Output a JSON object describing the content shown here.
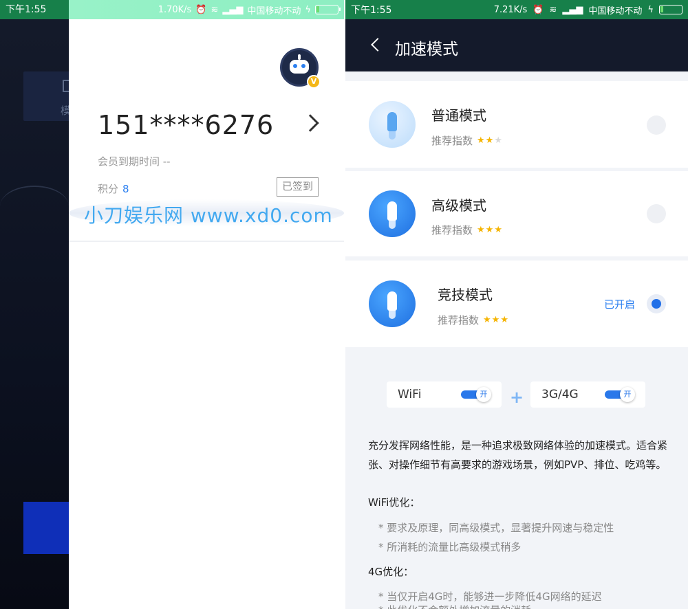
{
  "left": {
    "bg_status_time": "下午1:55",
    "bg_card_text": "模",
    "status": {
      "speed": "1.70K/s",
      "carrier": "中国移动不动"
    },
    "avatar_badge": "V",
    "phone": "151****6276",
    "member_expiry": "会员到期时间 --",
    "points_label": "积分",
    "points_value": "8",
    "signed_label": "已签到",
    "watermark": "小刀娱乐网  www.xd0.com"
  },
  "right": {
    "status": {
      "time": "下午1:55",
      "speed": "7.21K/s",
      "carrier": "中国移动不动"
    },
    "title": "加速模式",
    "modes": [
      {
        "name": "普通模式",
        "rating_label": "推荐指数",
        "stars_on": 2,
        "stars_total": 3,
        "selected": false
      },
      {
        "name": "高级模式",
        "rating_label": "推荐指数",
        "stars_on": 3,
        "stars_total": 3,
        "selected": false
      },
      {
        "name": "竞技模式",
        "rating_label": "推荐指数",
        "stars_on": 3,
        "stars_total": 3,
        "selected": true,
        "status": "已开启"
      }
    ],
    "toggles": [
      {
        "label": "WiFi",
        "state": "开"
      },
      {
        "label": "3G/4G",
        "state": "开"
      }
    ],
    "description": "充分发挥网络性能，是一种追求极致网络体验的加速模式。适合紧张、对操作细节有高要求的游戏场景，例如PVP、排位、吃鸡等。",
    "wifi_section": {
      "title": "WiFi优化：",
      "items": [
        "* 要求及原理，同高级模式，显著提升网速与稳定性",
        "* 所消耗的流量比高级模式稍多"
      ]
    },
    "g4_section": {
      "title": "4G优化：",
      "items": [
        "* 当仅开启4G时，能够进一步降低4G网络的延迟",
        "* 此优化不会额外增加流量的消耗"
      ]
    },
    "colors": {
      "accent": "#2170e8",
      "header": "#141a2b",
      "status_bar": "#17804a",
      "star": "#f5b400"
    }
  }
}
